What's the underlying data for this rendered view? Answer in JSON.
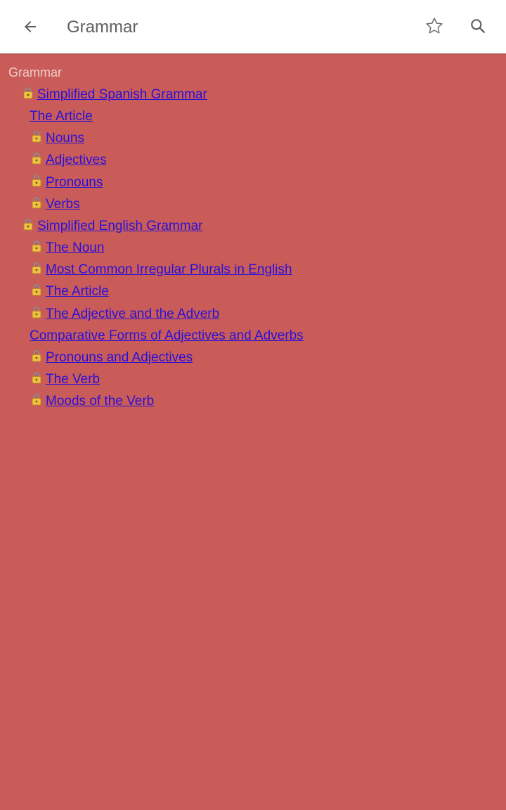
{
  "app_bar": {
    "title": "Grammar",
    "back_icon": "arrow-left-icon",
    "favorite_icon": "star-outline-icon",
    "search_icon": "search-icon"
  },
  "colors": {
    "background": "#c95c59",
    "link": "#2a10d8",
    "heading": "#f2cccb"
  },
  "content": {
    "heading": "Grammar",
    "items": [
      {
        "label": "Simplified Spanish Grammar",
        "locked": true,
        "level": 1
      },
      {
        "label": "The Article",
        "locked": false,
        "level": 2
      },
      {
        "label": "Nouns",
        "locked": true,
        "level": 2
      },
      {
        "label": "Adjectives",
        "locked": true,
        "level": 2
      },
      {
        "label": "Pronouns",
        "locked": true,
        "level": 2
      },
      {
        "label": "Verbs",
        "locked": true,
        "level": 2
      },
      {
        "label": "Simplified English Grammar",
        "locked": true,
        "level": 1
      },
      {
        "label": "The Noun",
        "locked": true,
        "level": 2
      },
      {
        "label": "Most Common Irregular Plurals in English",
        "locked": true,
        "level": 2
      },
      {
        "label": "The Article",
        "locked": true,
        "level": 2
      },
      {
        "label": "The Adjective and the Adverb",
        "locked": true,
        "level": 2
      },
      {
        "label": "Comparative Forms of Adjectives and Adverbs",
        "locked": false,
        "level": 2
      },
      {
        "label": "Pronouns and Adjectives",
        "locked": true,
        "level": 2
      },
      {
        "label": "The Verb",
        "locked": true,
        "level": 2
      },
      {
        "label": "Moods of the Verb",
        "locked": true,
        "level": 2
      }
    ]
  }
}
